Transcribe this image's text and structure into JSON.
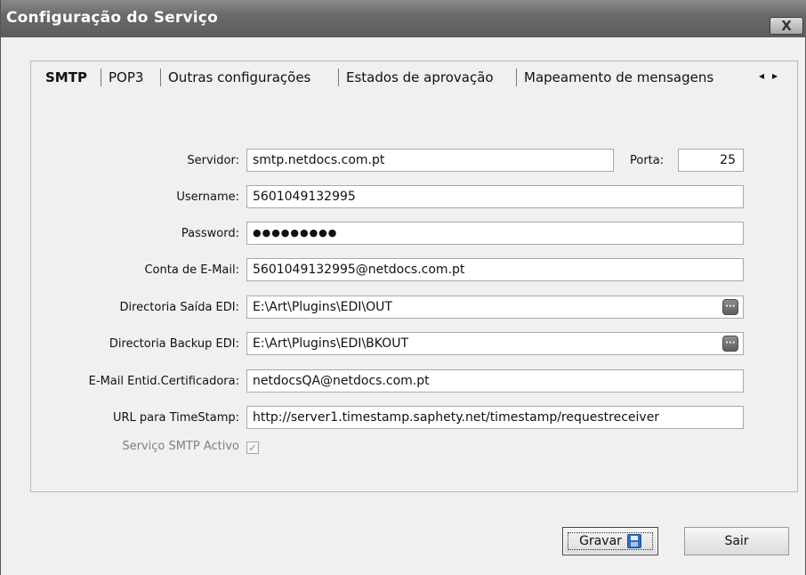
{
  "window": {
    "title": "Configuração do Serviço",
    "close_label": "X"
  },
  "tabs": [
    {
      "label": "SMTP",
      "active": true
    },
    {
      "label": "POP3"
    },
    {
      "label": "Outras configurações"
    },
    {
      "label": "Estados de aprovação"
    },
    {
      "label": "Mapeamento de mensagens"
    }
  ],
  "tab_scroll": {
    "left": "◂",
    "right": "▸"
  },
  "form": {
    "server": {
      "label": "Servidor:",
      "value": "smtp.netdocs.com.pt"
    },
    "port": {
      "label": "Porta:",
      "value": "25"
    },
    "username": {
      "label": "Username:",
      "value": "5601049132995"
    },
    "password": {
      "label": "Password:",
      "value": "●●●●●●●●●"
    },
    "email_account": {
      "label": "Conta de E-Mail:",
      "value": "5601049132995@netdocs.com.pt"
    },
    "edi_out_dir": {
      "label": "Directoria Saída EDI:",
      "value": "E:\\Art\\Plugins\\EDI\\OUT"
    },
    "edi_backup_dir": {
      "label": "Directoria Backup EDI:",
      "value": "E:\\Art\\Plugins\\EDI\\BKOUT"
    },
    "cert_email": {
      "label": "E-Mail Entid.Certificadora:",
      "value": "netdocsQA@netdocs.com.pt"
    },
    "timestamp_url": {
      "label": "URL para TimeStamp:",
      "value": "http://server1.timestamp.saphety.net/timestamp/requestreceiver"
    },
    "smtp_active": {
      "label": "Serviço SMTP Activo",
      "checked": true,
      "mark": "✓"
    },
    "browse_label": "···"
  },
  "buttons": {
    "save": "Gravar",
    "exit": "Sair"
  }
}
